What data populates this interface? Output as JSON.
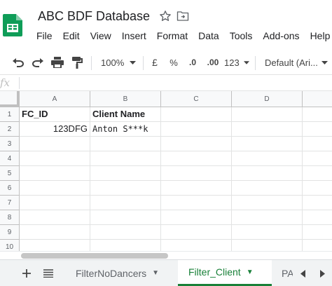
{
  "document": {
    "title": "ABC BDF Database"
  },
  "menu": [
    "File",
    "Edit",
    "View",
    "Insert",
    "Format",
    "Data",
    "Tools",
    "Add-ons",
    "Help"
  ],
  "toolbar": {
    "zoom": "100%",
    "currency": "£",
    "percent": "%",
    "decrease_decimals": ".0",
    "increase_decimals": ".00",
    "more_formats": "123",
    "font": "Default (Ari..."
  },
  "formula_bar": {
    "fx": "fx",
    "value": ""
  },
  "grid": {
    "columns": [
      "A",
      "B",
      "C",
      "D"
    ],
    "rows": [
      "1",
      "2",
      "3",
      "4",
      "5",
      "6",
      "7",
      "8",
      "9",
      "10"
    ],
    "cells": {
      "A1": "FC_ID",
      "B1": "Client Name",
      "A2": "123DFG",
      "B2": "Anton S***k"
    }
  },
  "sheets": {
    "tabs": [
      {
        "label": "FilterNoDancers",
        "active": false
      },
      {
        "label": "Filter_Client",
        "active": true
      },
      {
        "label": "PA",
        "active": false
      }
    ]
  },
  "colors": {
    "accent_green": "#188038",
    "logo_green": "#0f9d58"
  }
}
